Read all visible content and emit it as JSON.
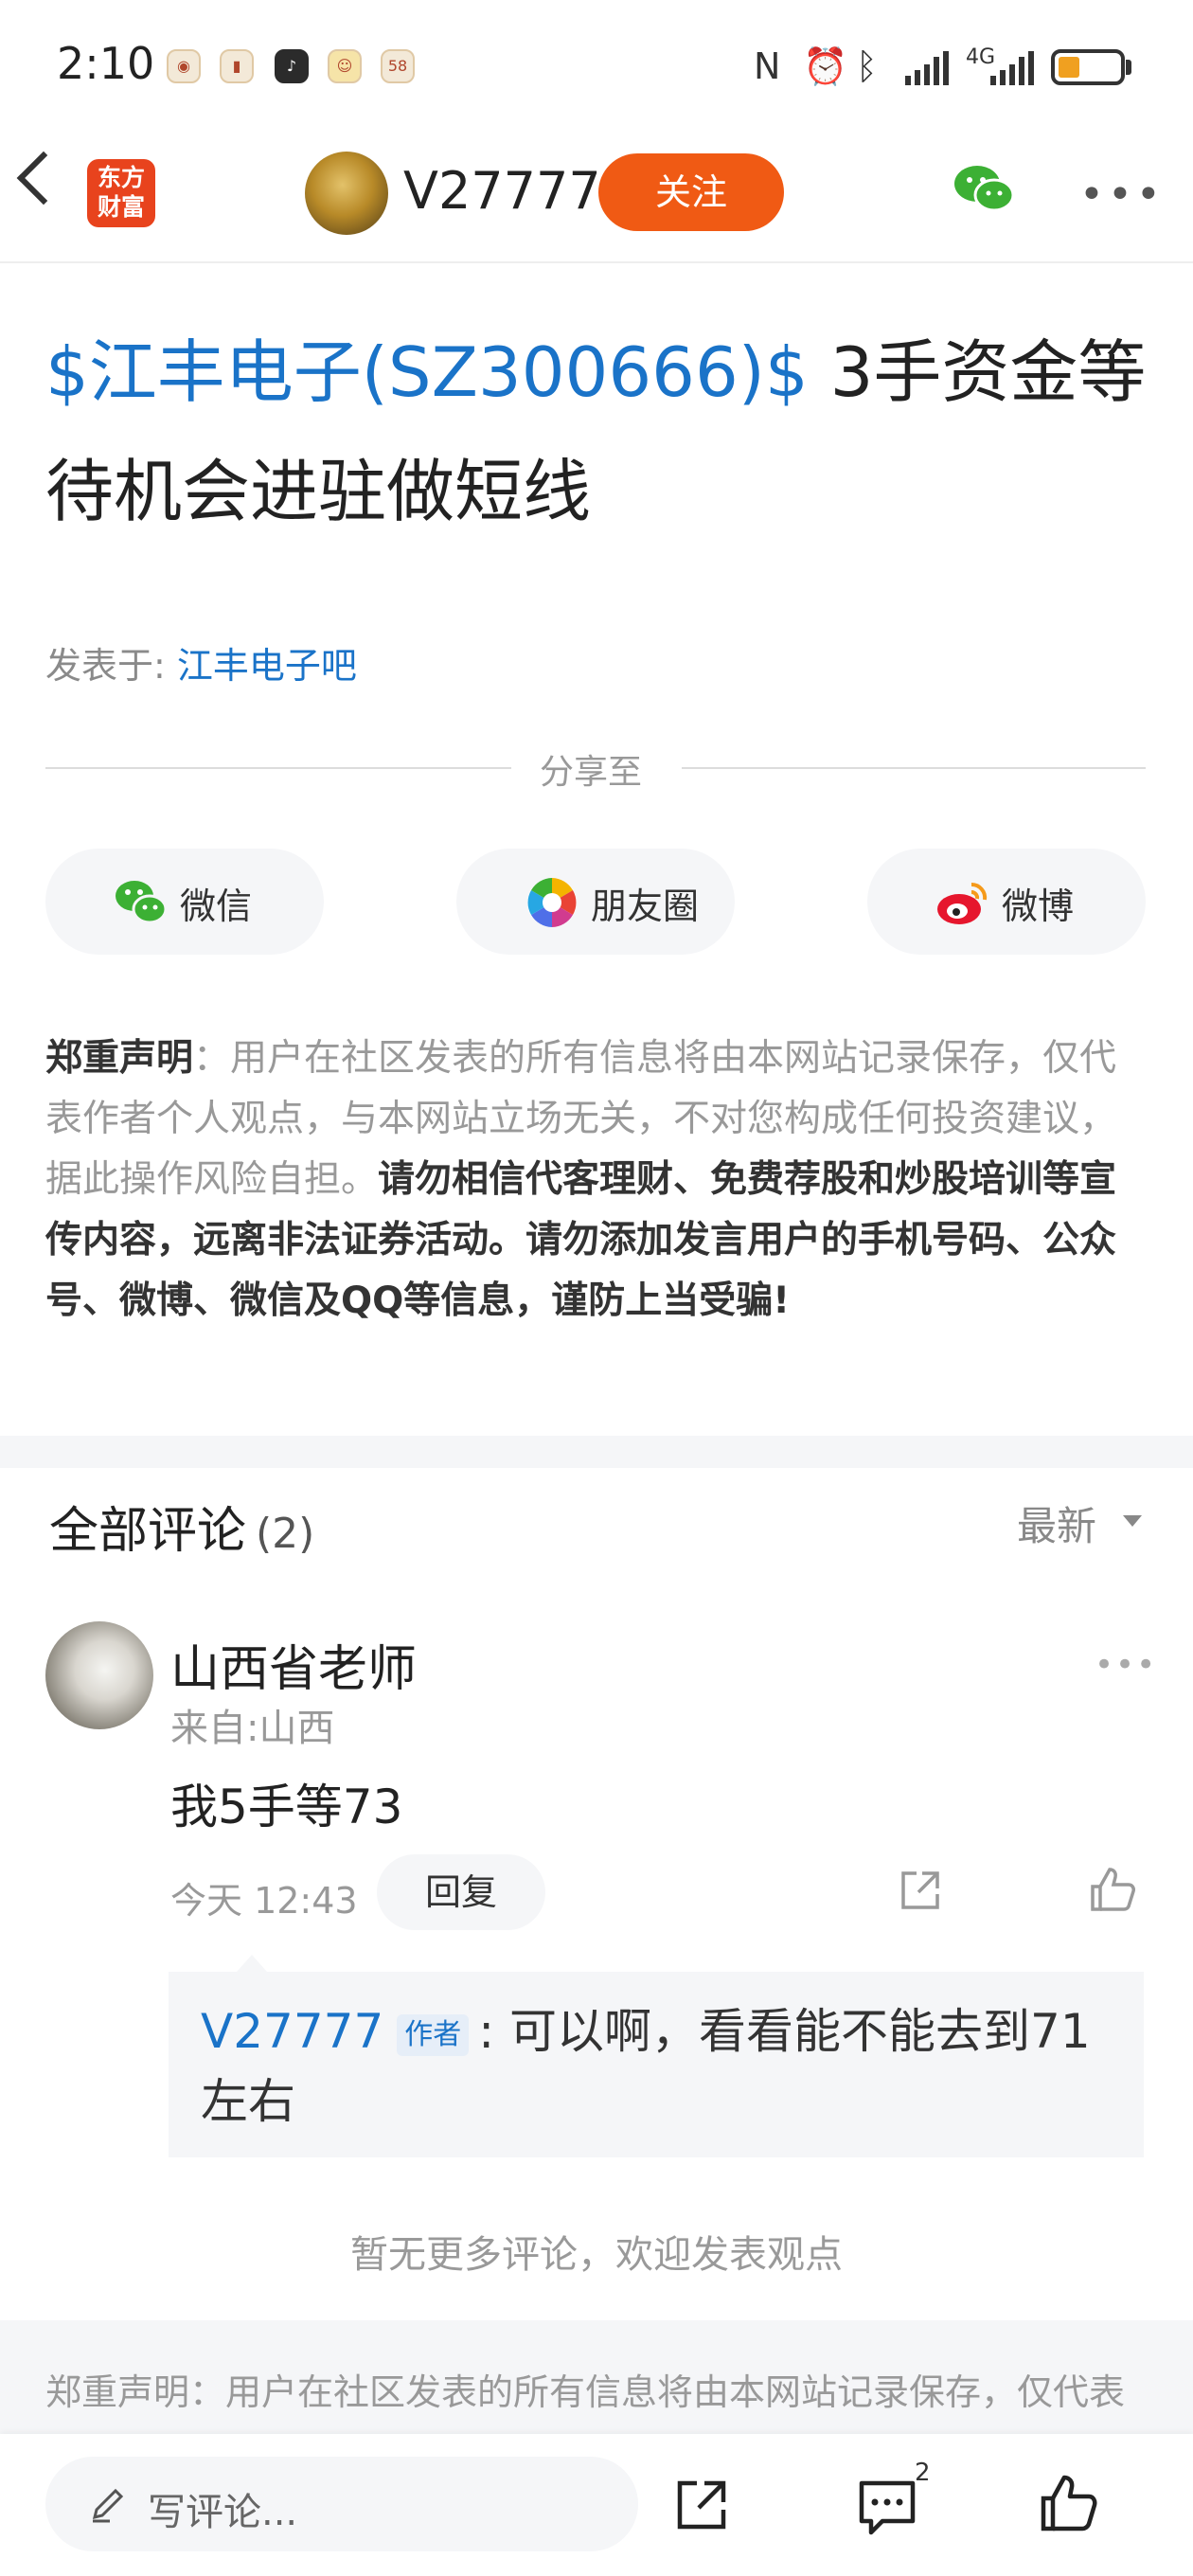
{
  "status_bar": {
    "time": "2:10",
    "notif_icons": [
      "news-icon",
      "red-app-icon",
      "tiktok-icon",
      "message-icon",
      "58"
    ],
    "network": "4G"
  },
  "header": {
    "logo_line1": "东方",
    "logo_line2": "财富",
    "username": "V27777",
    "follow_label": "关注"
  },
  "post": {
    "stock_tag": "$江丰电子(SZ300666)$",
    "title_text": " 3手资金等待机会进驻做短线",
    "posted_prefix": "发表于: ",
    "board": "江丰电子吧"
  },
  "share": {
    "label": "分享至",
    "buttons": [
      "微信",
      "朋友圈",
      "微博"
    ]
  },
  "disclaimer": {
    "bold_head": "郑重声明",
    "normal": "：用户在社区发表的所有信息将由本网站记录保存，仅代表作者个人观点，与本网站立场无关，不对您构成任何投资建议，据此操作风险自担。",
    "bold_tail": "请勿相信代客理财、免费荐股和炒股培训等宣传内容，远离非法证券活动。请勿添加发言用户的手机号码、公众号、微博、微信及QQ等信息，谨防上当受骗!"
  },
  "comments": {
    "title": "全部评论",
    "count": "(2)",
    "sort_label": "最新",
    "items": [
      {
        "name": "山西省老师",
        "from": "来自:山西",
        "text": "我5手等73",
        "time": "今天 12:43",
        "reply_label": "回复",
        "reply": {
          "user": "V27777",
          "badge": "作者",
          "text": ": 可以啊，看看能不能去到71左右"
        }
      }
    ],
    "no_more": "暂无更多评论，欢迎发表观点"
  },
  "bottom_disclaimer": "郑重声明：用户在社区发表的所有信息将由本网站记录保存，仅代表作者个人观点，与本网站立场无关，不对您构成任何投资建议",
  "toolbar": {
    "write_placeholder": "写评论...",
    "comment_count": "2"
  },
  "colors": {
    "accent_blue": "#1a73c8",
    "follow_orange": "#f05a14",
    "logo_red": "#e8431d"
  }
}
